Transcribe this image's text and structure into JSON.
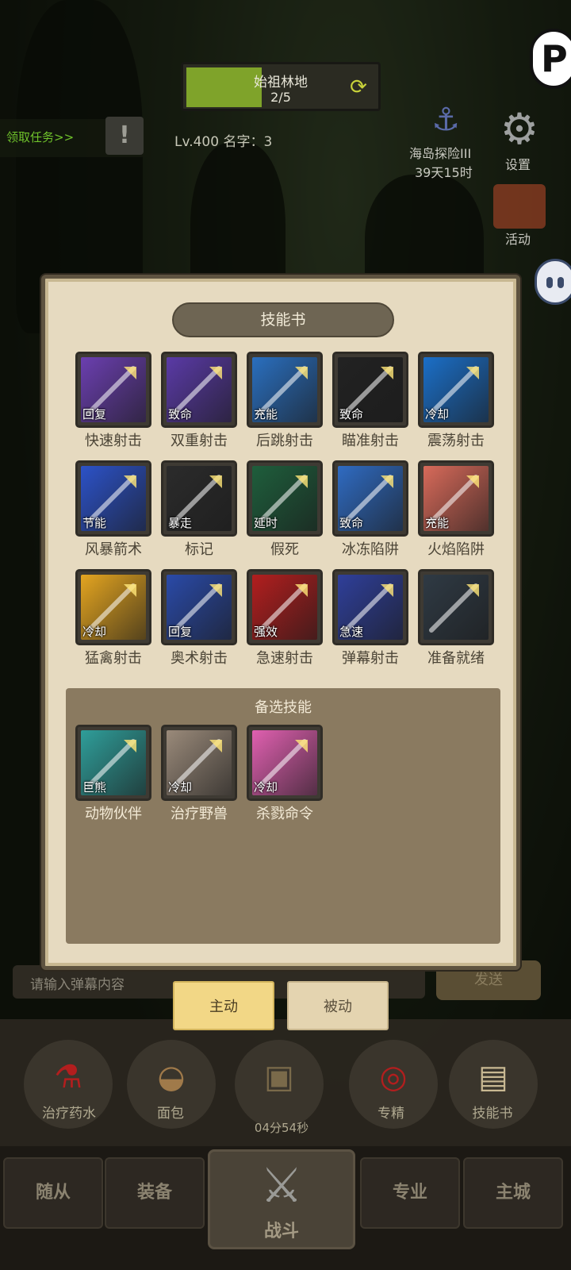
{
  "hud": {
    "stage_name": "始祖林地",
    "stage_progress": "2/5",
    "stage_progress_fraction": 0.4,
    "quest_link": "领取任务>>",
    "player_info": "Lv.400 名字：3",
    "event_name": "海岛探险III",
    "event_time": "39天15时",
    "settings_label": "设置",
    "activity_label": "活动",
    "chat_placeholder": "请输入弹幕内容",
    "send_label": "发送"
  },
  "dialog": {
    "title": "技能书",
    "skills": [
      {
        "name": "快速射击",
        "tag": "回复",
        "color": "#6b3fb0"
      },
      {
        "name": "双重射击",
        "tag": "致命",
        "color": "#5a3aa6"
      },
      {
        "name": "后跳射击",
        "tag": "充能",
        "color": "#2a6fbf"
      },
      {
        "name": "瞄准射击",
        "tag": "致命",
        "color": "#222222"
      },
      {
        "name": "震荡射击",
        "tag": "冷却",
        "color": "#1b6fc8"
      },
      {
        "name": "风暴箭术",
        "tag": "节能",
        "color": "#2c52c8"
      },
      {
        "name": "标记",
        "tag": "暴走",
        "color": "#2b2b2b"
      },
      {
        "name": "假死",
        "tag": "延时",
        "color": "#1e5e3c"
      },
      {
        "name": "冰冻陷阱",
        "tag": "致命",
        "color": "#2f6bc2"
      },
      {
        "name": "火焰陷阱",
        "tag": "充能",
        "color": "#d86a5a"
      },
      {
        "name": "猛禽射击",
        "tag": "冷却",
        "color": "#e4a520"
      },
      {
        "name": "奥术射击",
        "tag": "回复",
        "color": "#2a4aa8"
      },
      {
        "name": "急速射击",
        "tag": "强效",
        "color": "#b21e1e"
      },
      {
        "name": "弹幕射击",
        "tag": "急速",
        "color": "#2f3f9a"
      },
      {
        "name": "准备就绪",
        "tag": "",
        "color": "#2f3a44"
      }
    ],
    "alt_title": "备选技能",
    "alt_skills": [
      {
        "name": "动物伙伴",
        "tag": "巨熊",
        "color": "#2f9e9a"
      },
      {
        "name": "治疗野兽",
        "tag": "冷却",
        "color": "#9a8a7a"
      },
      {
        "name": "杀戮命令",
        "tag": "冷却",
        "color": "#e060b0"
      }
    ]
  },
  "tabs": {
    "active": "主动",
    "passive": "被动"
  },
  "items": [
    {
      "label": "治疗药水",
      "icon": "potion-icon"
    },
    {
      "label": "面包",
      "icon": "bread-icon"
    },
    {
      "label": "04分54秒",
      "icon": "chest-icon"
    },
    {
      "label": "专精",
      "icon": "target-icon"
    },
    {
      "label": "技能书",
      "icon": "book-icon"
    }
  ],
  "nav": {
    "follower": "随从",
    "equipment": "装备",
    "battle": "战斗",
    "profession": "专业",
    "city": "主城"
  }
}
